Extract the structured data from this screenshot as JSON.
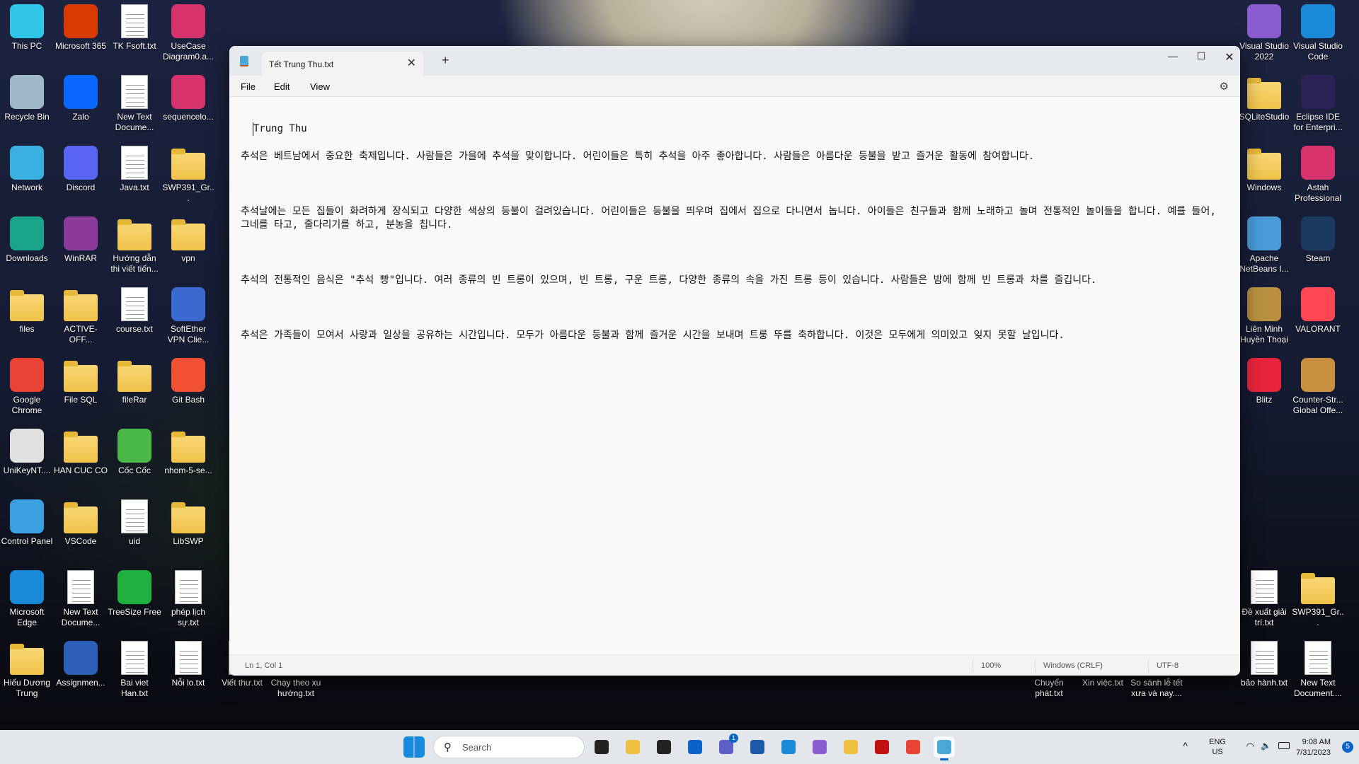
{
  "desktop_icons": [
    {
      "label": "This PC",
      "type": "app",
      "color": "#2fc6e8",
      "col": 0,
      "row": 0
    },
    {
      "label": "Microsoft 365",
      "type": "app",
      "color": "#d83b01",
      "col": 1,
      "row": 0
    },
    {
      "label": "TK Fsoft.txt",
      "type": "doc",
      "col": 2,
      "row": 0
    },
    {
      "label": "UseCase Diagram0.a...",
      "type": "app",
      "color": "#d6336c",
      "col": 3,
      "row": 0
    },
    {
      "label": "Recycle Bin",
      "type": "app",
      "color": "#9fb8c8",
      "col": 0,
      "row": 1
    },
    {
      "label": "Zalo",
      "type": "app",
      "color": "#0a68ff",
      "col": 1,
      "row": 1
    },
    {
      "label": "New Text Docume...",
      "type": "doc",
      "col": 2,
      "row": 1
    },
    {
      "label": "sequencelo...",
      "type": "app",
      "color": "#d6336c",
      "col": 3,
      "row": 1
    },
    {
      "label": "Network",
      "type": "app",
      "color": "#3ab0e0",
      "col": 0,
      "row": 2
    },
    {
      "label": "Discord",
      "type": "app",
      "color": "#5865f2",
      "col": 1,
      "row": 2
    },
    {
      "label": "Java.txt",
      "type": "doc",
      "col": 2,
      "row": 2
    },
    {
      "label": "SWP391_Gr...",
      "type": "folder",
      "col": 3,
      "row": 2
    },
    {
      "label": "Downloads",
      "type": "app",
      "color": "#1aa58a",
      "col": 0,
      "row": 3
    },
    {
      "label": "WinRAR",
      "type": "app",
      "color": "#8a3a9a",
      "col": 1,
      "row": 3
    },
    {
      "label": "Hướng dẫn thi viết tiến...",
      "type": "folder",
      "col": 2,
      "row": 3
    },
    {
      "label": "vpn",
      "type": "folder",
      "col": 3,
      "row": 3
    },
    {
      "label": "files",
      "type": "folder",
      "col": 0,
      "row": 4
    },
    {
      "label": "ACTIVE-OFF...",
      "type": "folder",
      "col": 1,
      "row": 4
    },
    {
      "label": "course.txt",
      "type": "doc",
      "col": 2,
      "row": 4
    },
    {
      "label": "SoftEther VPN Clie...",
      "type": "app",
      "color": "#3a6ad0",
      "col": 3,
      "row": 4
    },
    {
      "label": "Google Chrome",
      "type": "app",
      "color": "#e84335",
      "col": 0,
      "row": 5
    },
    {
      "label": "File SQL",
      "type": "folder",
      "col": 1,
      "row": 5
    },
    {
      "label": "fileRar",
      "type": "folder",
      "col": 2,
      "row": 5
    },
    {
      "label": "Git Bash",
      "type": "app",
      "color": "#f05033",
      "col": 3,
      "row": 5
    },
    {
      "label": "UniKeyNT....",
      "type": "app",
      "color": "#e0e0e0",
      "col": 0,
      "row": 6
    },
    {
      "label": "HAN CUC CO",
      "type": "folder",
      "col": 1,
      "row": 6
    },
    {
      "label": "Cốc Cốc",
      "type": "app",
      "color": "#4ab848",
      "col": 2,
      "row": 6
    },
    {
      "label": "nhom-5-se...",
      "type": "folder",
      "col": 3,
      "row": 6
    },
    {
      "label": "Control Panel",
      "type": "app",
      "color": "#3aa0e0",
      "col": 0,
      "row": 7
    },
    {
      "label": "VSCode",
      "type": "folder",
      "col": 1,
      "row": 7
    },
    {
      "label": "uid",
      "type": "doc",
      "col": 2,
      "row": 7
    },
    {
      "label": "LibSWP",
      "type": "folder",
      "col": 3,
      "row": 7
    },
    {
      "label": "Microsoft Edge",
      "type": "app",
      "color": "#1a8ad8",
      "col": 0,
      "row": 8
    },
    {
      "label": "New Text Docume...",
      "type": "doc",
      "col": 1,
      "row": 8
    },
    {
      "label": "TreeSize Free",
      "type": "app",
      "color": "#20b040",
      "col": 2,
      "row": 8
    },
    {
      "label": "phép lịch sự.txt",
      "type": "doc",
      "col": 3,
      "row": 8
    },
    {
      "label": "Hiếu Dương Trung",
      "type": "folder",
      "col": 0,
      "row": 9
    },
    {
      "label": "Assignmen...",
      "type": "app",
      "color": "#2b5fb8",
      "col": 1,
      "row": 9
    },
    {
      "label": "Bai viet Han.txt",
      "type": "doc",
      "col": 2,
      "row": 9
    },
    {
      "label": "Nỗi lo.txt",
      "type": "doc",
      "col": 3,
      "row": 9
    },
    {
      "label": "Viết thư.txt",
      "type": "doc",
      "col": 4,
      "row": 9
    },
    {
      "label": "Chạy theo xu hướng.txt",
      "type": "doc",
      "col": 5,
      "row": 9
    },
    {
      "label": "Visual Studio 2022",
      "type": "app",
      "color": "#8a5cd0",
      "col": "r0",
      "row": 0
    },
    {
      "label": "Visual Studio Code",
      "type": "app",
      "color": "#1a8ad8",
      "col": "r1",
      "row": 0
    },
    {
      "label": "SQLiteStudio",
      "type": "folder",
      "col": "r0",
      "row": 1
    },
    {
      "label": "Eclipse IDE for Enterpri...",
      "type": "app",
      "color": "#2c2255",
      "col": "r1",
      "row": 1
    },
    {
      "label": "Windows",
      "type": "folder",
      "col": "r0",
      "row": 2
    },
    {
      "label": "Astah Professional",
      "type": "app",
      "color": "#d6336c",
      "col": "r1",
      "row": 2
    },
    {
      "label": "Apache NetBeans I...",
      "type": "app",
      "color": "#4a9ad8",
      "col": "r0",
      "row": 3
    },
    {
      "label": "Steam",
      "type": "app",
      "color": "#1a3a60",
      "col": "r1",
      "row": 3
    },
    {
      "label": "Liên Minh Huyền Thoại",
      "type": "app",
      "color": "#b89040",
      "col": "r0",
      "row": 4
    },
    {
      "label": "VALORANT",
      "type": "app",
      "color": "#ff4655",
      "col": "r1",
      "row": 4
    },
    {
      "label": "Blitz",
      "type": "app",
      "color": "#e8243c",
      "col": "r0",
      "row": 5
    },
    {
      "label": "Counter-Str... Global Offe...",
      "type": "app",
      "color": "#c89040",
      "col": "r1",
      "row": 5
    },
    {
      "label": "Đề xuất giải trí.txt",
      "type": "doc",
      "col": "r0",
      "row": 8
    },
    {
      "label": "SWP391_Gr...",
      "type": "folder",
      "col": "r1",
      "row": 8
    },
    {
      "label": "Chuyển phát.txt",
      "type": "doc",
      "col": "r-4",
      "row": 9
    },
    {
      "label": "Xin việc.txt",
      "type": "doc",
      "col": "r-3",
      "row": 9
    },
    {
      "label": "So sánh lễ tết xưa và nay....",
      "type": "doc",
      "col": "r-2",
      "row": 9
    },
    {
      "label": "bảo hành.txt",
      "type": "doc",
      "col": "r0",
      "row": 9
    },
    {
      "label": "New Text Document....",
      "type": "doc",
      "col": "r1",
      "row": 9
    }
  ],
  "notepad": {
    "app_icon": "notepad-icon",
    "tab_title": "Tết Trung Thu.txt",
    "menu": [
      "File",
      "Edit",
      "View"
    ],
    "content": {
      "title_line": "Trung Thu",
      "paragraphs": [
        "추석은 베트남에서 중요한 축제입니다. 사람들은 가을에 추석을 맞이합니다. 어린이들은 특히 추석을 아주 좋아합니다. 사람들은 아름다운 등불을 받고 즐거운 활동에 참여합니다.",
        "추석날에는 모든 집들이 화려하게 장식되고 다양한 색상의 등불이 걸려있습니다. 어린이들은 등불을 띄우며 집에서 집으로 다니면서 놉니다. 아이들은 친구들과 함께 노래하고 놀며 전통적인 놀이들을 합니다. 예를 들어, 그네를 타고, 줄다리기를 하고, 분농을 칩니다.",
        "추석의 전통적인 음식은 \"추석 빵\"입니다. 여러 종류의 빈 트롱이 있으며, 빈 트롱, 구운 트롱, 다양한 종류의 속을 가진 트롱 등이 있습니다. 사람들은 밤에 함께 빈 트롱과 차를 즐깁니다.",
        "추석은 가족들이 모여서 사랑과 일상을 공유하는 시간입니다. 모두가 아름다운 등불과 함께 즐거운 시간을 보내며 트룽 뚜를 축하합니다. 이것은 모두에게 의미있고 잊지 못할 날입니다."
      ]
    },
    "status": {
      "position": "Ln 1, Col 1",
      "zoom": "100%",
      "line_ending": "Windows (CRLF)",
      "encoding": "UTF-8"
    }
  },
  "taskbar": {
    "search_placeholder": "Search",
    "apps": [
      {
        "name": "task-view",
        "color": "#222"
      },
      {
        "name": "devtool",
        "color": "#f0c040"
      },
      {
        "name": "notion",
        "color": "#222"
      },
      {
        "name": "outlook",
        "color": "#0a64c8"
      },
      {
        "name": "teams",
        "color": "#5b5fc7",
        "badge": "1"
      },
      {
        "name": "store",
        "color": "#1a5aa8"
      },
      {
        "name": "edge",
        "color": "#1a8ad8"
      },
      {
        "name": "visual-studio",
        "color": "#8a5cd0"
      },
      {
        "name": "file-explorer",
        "color": "#f0c040"
      },
      {
        "name": "garena",
        "color": "#c01010"
      },
      {
        "name": "chrome",
        "color": "#e84335"
      },
      {
        "name": "notepad",
        "color": "#4aa8d8",
        "active": true
      }
    ],
    "tray": {
      "lang_line1": "ENG",
      "lang_line2": "US",
      "time": "9:08 AM",
      "date": "7/31/2023",
      "notifications": "5"
    }
  }
}
